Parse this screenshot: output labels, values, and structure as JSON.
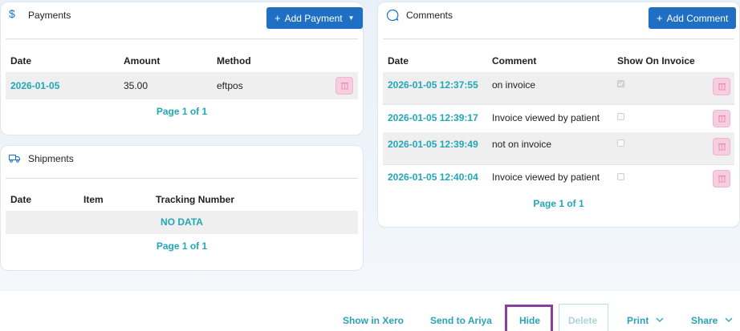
{
  "payments": {
    "title": "Payments",
    "add_button": "Add Payment",
    "columns": [
      "Date",
      "Amount",
      "Method"
    ],
    "rows": [
      {
        "date": "2026-01-05",
        "amount": "35.00",
        "method": "eftpos"
      }
    ],
    "pager": "Page 1 of 1"
  },
  "shipments": {
    "title": "Shipments",
    "columns": [
      "Date",
      "Item",
      "Tracking Number"
    ],
    "no_data": "NO DATA",
    "pager": "Page 1 of 1"
  },
  "comments": {
    "title": "Comments",
    "add_button": "Add Comment",
    "columns": [
      "Date",
      "Comment",
      "Show On Invoice"
    ],
    "rows": [
      {
        "date": "2026-01-05 12:37:55",
        "comment": "on invoice",
        "show_on_invoice": true
      },
      {
        "date": "2026-01-05 12:39:17",
        "comment": "Invoice viewed by patient",
        "show_on_invoice": false
      },
      {
        "date": "2026-01-05 12:39:49",
        "comment": "not on invoice",
        "show_on_invoice": false
      },
      {
        "date": "2026-01-05 12:40:04",
        "comment": "Invoice viewed by patient",
        "show_on_invoice": false
      }
    ],
    "pager": "Page 1 of 1"
  },
  "footer": {
    "show_in_xero": "Show in Xero",
    "send_to_ariya": "Send to Ariya",
    "hide": "Hide",
    "delete": "Delete",
    "print": "Print",
    "share": "Share"
  },
  "colors": {
    "primary": "#1f6fc4",
    "link": "#22a7b8",
    "delete_bg": "#f7cde0",
    "highlight": "#8a3ea0"
  }
}
